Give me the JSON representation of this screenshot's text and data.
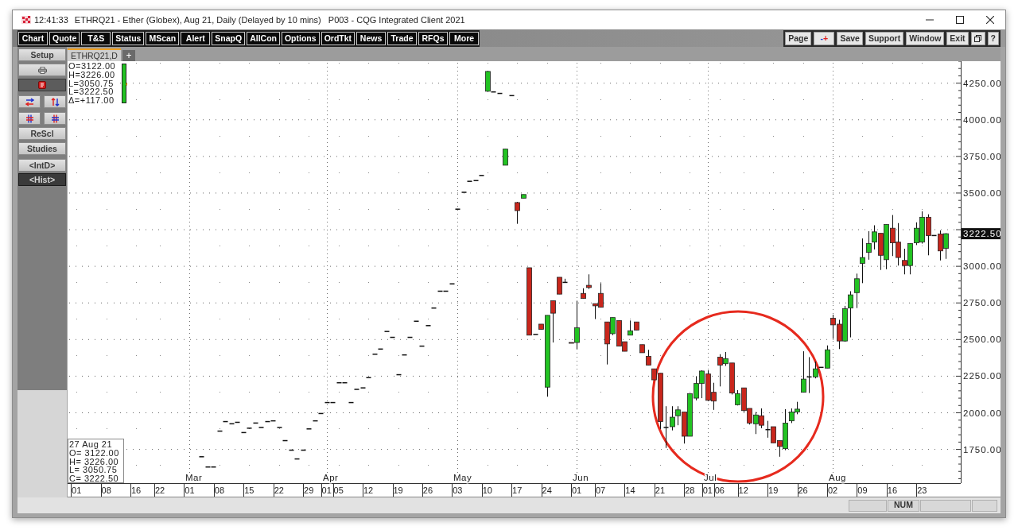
{
  "window": {
    "time": "12:41:33",
    "title": "ETHRQ21 - Ether (Globex), Aug 21, Daily (Delayed by 10 mins)",
    "app": "P003 - CQG Integrated Client 2021"
  },
  "toolbar": {
    "left": [
      "Chart",
      "Quote",
      "T&S",
      "Status",
      "MScan",
      "Alert",
      "SnapQ",
      "AllCon",
      "Options",
      "OrdTkt",
      "News",
      "Trade",
      "RFQs",
      "More"
    ],
    "right": [
      {
        "kind": "text",
        "label": "Page"
      },
      {
        "kind": "pair",
        "labels": [
          "-",
          "+"
        ]
      },
      {
        "kind": "text",
        "label": "Save"
      },
      {
        "kind": "text",
        "label": "Support"
      },
      {
        "kind": "text",
        "label": "Window"
      },
      {
        "kind": "text",
        "label": "Exit"
      },
      {
        "kind": "restore"
      },
      {
        "kind": "text",
        "label": "?"
      }
    ]
  },
  "sidebar": {
    "buttons": [
      {
        "kind": "text",
        "label": "Setup"
      },
      {
        "kind": "printer"
      },
      {
        "kind": "order",
        "pressed": true
      },
      {
        "kind": "arrows_pair"
      },
      {
        "kind": "hash_pair"
      },
      {
        "kind": "text",
        "label": "ReScl"
      },
      {
        "kind": "text",
        "label": "Studies"
      }
    ],
    "modes": [
      {
        "label": "<IntD>",
        "selected": false
      },
      {
        "label": "<Hist>",
        "selected": true
      }
    ]
  },
  "tabs": [
    {
      "label": "ETHRQ21,D",
      "selected": true
    }
  ],
  "add_tab": "+",
  "chart": {
    "readout": [
      "O=3122.00",
      "H=3226.00",
      "L=3050.75",
      "L=3222.50",
      "Δ=+117.00"
    ],
    "data_window": {
      "date": "27 Aug 21",
      "lines": [
        "O= 3122.00",
        "H= 3226.00",
        "L= 3050.75",
        "C= 3222.50"
      ]
    },
    "price_tag": "3222.50",
    "chart_data": {
      "type": "candlestick",
      "grid": true,
      "ylim": [
        1520,
        4400
      ],
      "yticks": [
        {
          "value": 1750,
          "label": "1750.00"
        },
        {
          "value": 2000,
          "label": "2000.00"
        },
        {
          "value": 2250,
          "label": "2250.00"
        },
        {
          "value": 2500,
          "label": "2500.00"
        },
        {
          "value": 2750,
          "label": "2750.00"
        },
        {
          "value": 3000,
          "label": "3000.00"
        },
        {
          "value": 3500,
          "label": "3500.00"
        },
        {
          "value": 3750,
          "label": "3750.00"
        },
        {
          "value": 4000,
          "label": "4000.00"
        },
        {
          "value": 4250,
          "label": "4250.00"
        }
      ],
      "annotations": [
        "Mar",
        "Apr",
        "May",
        "Jun",
        "Jul",
        "Aug"
      ],
      "categories": [
        null,
        "01",
        null,
        null,
        null,
        null,
        "08",
        null,
        null,
        null,
        null,
        "16",
        null,
        null,
        null,
        "22",
        null,
        null,
        null,
        null,
        "01",
        null,
        null,
        null,
        null,
        "08",
        null,
        null,
        null,
        null,
        "15",
        null,
        null,
        null,
        null,
        "22",
        null,
        null,
        null,
        null,
        "29",
        null,
        null,
        "01",
        null,
        "05",
        null,
        null,
        null,
        null,
        "12",
        null,
        null,
        null,
        null,
        "19",
        null,
        null,
        null,
        null,
        "26",
        null,
        null,
        null,
        null,
        "03",
        null,
        null,
        null,
        null,
        "10",
        null,
        null,
        null,
        null,
        "17",
        null,
        null,
        null,
        null,
        "24",
        null,
        null,
        null,
        null,
        "01",
        null,
        null,
        null,
        "07",
        null,
        null,
        null,
        null,
        "14",
        null,
        null,
        null,
        null,
        "21",
        null,
        null,
        null,
        null,
        "28",
        null,
        null,
        "01",
        null,
        "06",
        null,
        null,
        null,
        "12",
        null,
        null,
        null,
        null,
        "19",
        null,
        null,
        null,
        null,
        "26",
        null,
        null,
        null,
        null,
        "02",
        null,
        null,
        null,
        null,
        "09",
        null,
        null,
        null,
        null,
        "16",
        null,
        null,
        null,
        null,
        "23",
        null,
        null,
        null,
        null,
        null,
        null
      ],
      "ohlc": [
        null,
        null,
        null,
        null,
        null,
        null,
        null,
        null,
        null,
        null,
        null,
        null,
        null,
        null,
        null,
        null,
        null,
        null,
        null,
        null,
        null,
        null,
        [
          1700,
          1700,
          1700,
          1700
        ],
        [
          1630,
          1630,
          1630,
          1630
        ],
        [
          1630,
          1630,
          1630,
          1630
        ],
        [
          1875,
          1875,
          1875,
          1875
        ],
        [
          1940,
          1940,
          1940,
          1940
        ],
        [
          1925,
          1925,
          1925,
          1925
        ],
        [
          1935,
          1935,
          1935,
          1935
        ],
        [
          1865,
          1865,
          1865,
          1865
        ],
        [
          1895,
          1895,
          1895,
          1895
        ],
        [
          1930,
          1930,
          1930,
          1930
        ],
        [
          1900,
          1900,
          1900,
          1900
        ],
        [
          1940,
          1940,
          1940,
          1940
        ],
        [
          1945,
          1945,
          1945,
          1945
        ],
        [
          1900,
          1900,
          1900,
          1900
        ],
        [
          1810,
          1810,
          1810,
          1810
        ],
        [
          1745,
          1745,
          1745,
          1745
        ],
        [
          1685,
          1685,
          1685,
          1685
        ],
        [
          1745,
          1745,
          1745,
          1745
        ],
        [
          1890,
          1890,
          1890,
          1890
        ],
        [
          1945,
          1945,
          1945,
          1945
        ],
        [
          1995,
          1995,
          1995,
          1995
        ],
        [
          2070,
          2070,
          2070,
          2070
        ],
        [
          2070,
          2070,
          2070,
          2070
        ],
        [
          2205,
          2205,
          2205,
          2205
        ],
        [
          2205,
          2205,
          2205,
          2205
        ],
        [
          2070,
          2070,
          2070,
          2070
        ],
        [
          2160,
          2160,
          2160,
          2160
        ],
        [
          2170,
          2170,
          2170,
          2170
        ],
        [
          2240,
          2240,
          2240,
          2240
        ],
        [
          2400,
          2400,
          2400,
          2400
        ],
        [
          2435,
          2435,
          2435,
          2435
        ],
        [
          2555,
          2555,
          2555,
          2555
        ],
        [
          2515,
          2515,
          2515,
          2515
        ],
        [
          2260,
          2260,
          2260,
          2260
        ],
        [
          2395,
          2395,
          2395,
          2395
        ],
        [
          2515,
          2515,
          2515,
          2515
        ],
        [
          2625,
          2625,
          2625,
          2625
        ],
        [
          2455,
          2455,
          2455,
          2455
        ],
        [
          2595,
          2595,
          2595,
          2595
        ],
        [
          2715,
          2715,
          2715,
          2715
        ],
        [
          2830,
          2830,
          2830,
          2830
        ],
        [
          2830,
          2830,
          2830,
          2830
        ],
        [
          2880,
          2880,
          2880,
          2880
        ],
        [
          3390,
          3390,
          3390,
          3390
        ],
        [
          3505,
          3505,
          3505,
          3505
        ],
        [
          3580,
          3580,
          3580,
          3580
        ],
        [
          3585,
          3585,
          3585,
          3585
        ],
        [
          3620,
          3620,
          3620,
          3620
        ],
        [
          4195,
          4335,
          4190,
          4330
        ],
        [
          4190,
          4190,
          4190,
          4190
        ],
        [
          4180,
          4180,
          4180,
          4180
        ],
        [
          3690,
          3800,
          3690,
          3800
        ],
        [
          4165,
          4165,
          4165,
          4165
        ],
        [
          3435,
          3440,
          3290,
          3380
        ],
        [
          3465,
          3490,
          3465,
          3490
        ],
        [
          2990,
          2990,
          2530,
          2530
        ],
        [
          2535,
          2535,
          2535,
          2535
        ],
        [
          2605,
          2605,
          2570,
          2570
        ],
        [
          2175,
          2665,
          2110,
          2665
        ],
        [
          2765,
          2765,
          2480,
          2680
        ],
        [
          2925,
          2925,
          2810,
          2810
        ],
        [
          2890,
          2915,
          2890,
          2890
        ],
        [
          2480,
          2480,
          2475,
          2475
        ],
        [
          2480,
          2765,
          2435,
          2580
        ],
        [
          2815,
          2850,
          2780,
          2780
        ],
        [
          2870,
          2945,
          2845,
          2855
        ],
        [
          2745,
          2745,
          2640,
          2730
        ],
        [
          2815,
          2885,
          2720,
          2720
        ],
        [
          2620,
          2620,
          2330,
          2470
        ],
        [
          2540,
          2650,
          2530,
          2650
        ],
        [
          2630,
          2630,
          2455,
          2455
        ],
        [
          2485,
          2485,
          2420,
          2420
        ],
        [
          2530,
          2630,
          2530,
          2560
        ],
        [
          2620,
          2620,
          2565,
          2565
        ],
        [
          2465,
          2465,
          2410,
          2410
        ],
        [
          2385,
          2430,
          2325,
          2325
        ],
        [
          2300,
          2300,
          2225,
          2225
        ],
        [
          2270,
          2270,
          1890,
          1940
        ],
        [
          1900,
          2045,
          1760,
          1900
        ],
        [
          1905,
          2045,
          1880,
          1970
        ],
        [
          1980,
          2045,
          1915,
          2020
        ],
        [
          2005,
          2005,
          1790,
          1840
        ],
        [
          1840,
          2130,
          1840,
          2130
        ],
        [
          2100,
          2250,
          2085,
          2200
        ],
        [
          2200,
          2290,
          2100,
          2285
        ],
        [
          2265,
          2290,
          2080,
          2085
        ],
        [
          2140,
          2205,
          2020,
          2080
        ],
        [
          2380,
          2400,
          2180,
          2325
        ],
        [
          2335,
          2415,
          2320,
          2370
        ],
        [
          2340,
          2340,
          2125,
          2135
        ],
        [
          2055,
          2155,
          2050,
          2130
        ],
        [
          2170,
          2170,
          2005,
          2015
        ],
        [
          2030,
          2030,
          1920,
          1930
        ],
        [
          1925,
          2005,
          1855,
          1985
        ],
        [
          1980,
          2030,
          1895,
          1915
        ],
        [
          1885,
          1945,
          1830,
          1885
        ],
        [
          1905,
          1905,
          1795,
          1795
        ],
        [
          1810,
          1810,
          1700,
          1770
        ],
        [
          1755,
          2025,
          1745,
          1930
        ],
        [
          1945,
          2030,
          1930,
          2005
        ],
        [
          2005,
          2075,
          1990,
          2025
        ],
        [
          2140,
          2420,
          2140,
          2230
        ],
        [
          2245,
          2380,
          2135,
          2245
        ],
        [
          2245,
          2350,
          2235,
          2300
        ],
        [
          2310,
          2310,
          2310,
          2310
        ],
        [
          2305,
          2460,
          2305,
          2430
        ],
        [
          2645,
          2670,
          2505,
          2600
        ],
        [
          2605,
          2635,
          2435,
          2490
        ],
        [
          2490,
          2730,
          2485,
          2710
        ],
        [
          2715,
          2830,
          2515,
          2805
        ],
        [
          2820,
          2950,
          2715,
          2915
        ],
        [
          3020,
          3190,
          2885,
          3060
        ],
        [
          3095,
          3240,
          3045,
          3155
        ],
        [
          3165,
          3280,
          3115,
          3235
        ],
        [
          3225,
          3225,
          2975,
          3075
        ],
        [
          3045,
          3285,
          2980,
          3285
        ],
        [
          3260,
          3350,
          3070,
          3160
        ],
        [
          3165,
          3295,
          3005,
          3060
        ],
        [
          3040,
          3120,
          2945,
          3005
        ],
        [
          3005,
          3155,
          2945,
          3155
        ],
        [
          3160,
          3300,
          3145,
          3260
        ],
        [
          3165,
          3375,
          3155,
          3335
        ],
        [
          3335,
          3355,
          3075,
          3210
        ],
        [
          3210,
          3210,
          3210,
          3210
        ],
        [
          3220,
          3245,
          3040,
          3105
        ],
        [
          3122,
          3226,
          3050.75,
          3222.5
        ],
        null,
        null
      ]
    }
  },
  "status_bar": {
    "indicators": [
      "NUM"
    ]
  }
}
